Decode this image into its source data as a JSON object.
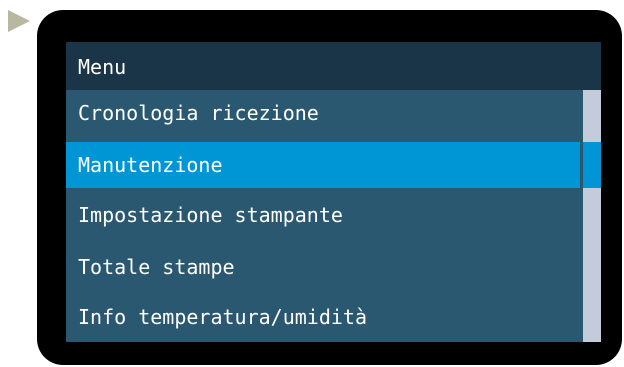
{
  "header": {
    "title": "Menu"
  },
  "menu": {
    "items": [
      {
        "label": "Cronologia ricezione",
        "selected": false
      },
      {
        "label": "Manutenzione",
        "selected": true
      },
      {
        "label": "Impostazione stampante",
        "selected": false
      },
      {
        "label": "Totale stampe",
        "selected": false
      },
      {
        "label": "Info temperatura/umidità",
        "selected": false
      }
    ]
  },
  "icons": {
    "pointer": "play-arrow-icon"
  },
  "colors": {
    "bezel": "#000000",
    "header_bg": "#1a3548",
    "list_bg": "#2a5870",
    "selection": "#0096d6",
    "scroll_track": "#c4ccdc",
    "pointer": "#b8b8a0",
    "text": "#ffffff"
  }
}
